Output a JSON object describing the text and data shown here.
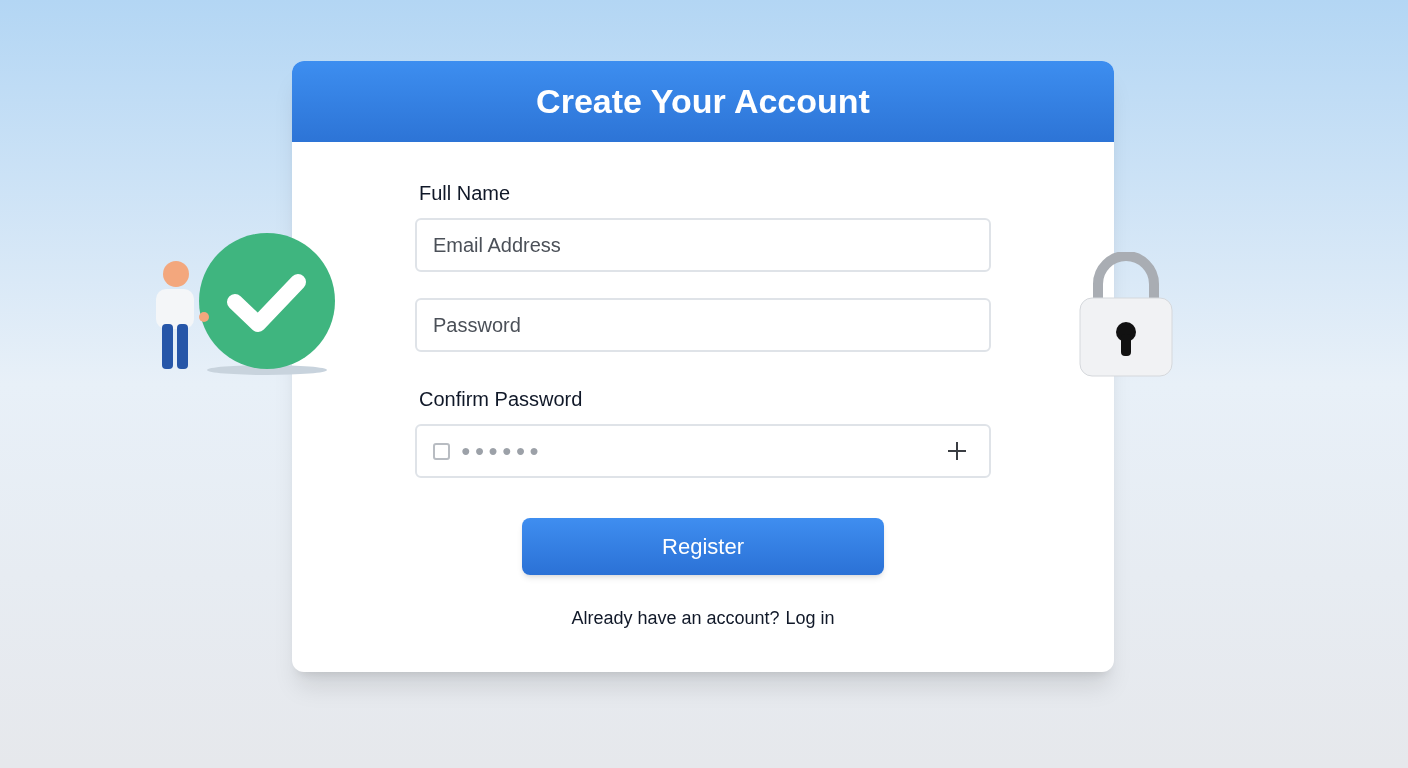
{
  "card": {
    "title": "Create Your Account"
  },
  "fields": [
    {
      "kind": "label",
      "text": "Full Name"
    },
    {
      "kind": "input",
      "placeholder": "Email Address"
    },
    {
      "kind": "input",
      "placeholder": "Password"
    },
    {
      "kind": "label",
      "text": "Confirm Password"
    },
    {
      "kind": "masked",
      "value": "●●●●●●",
      "checked": false
    }
  ],
  "button": {
    "label": "Register"
  },
  "footer": {
    "text": "Already have an account?",
    "link": "Log in"
  }
}
